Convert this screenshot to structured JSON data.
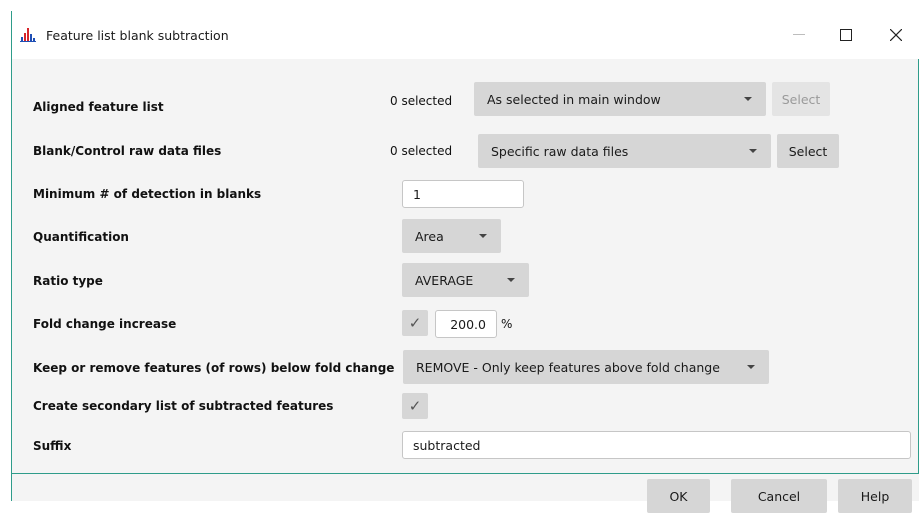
{
  "window": {
    "title": "Feature list blank subtraction",
    "minimize_icon": "minimize-icon",
    "maximize_icon": "maximize-icon",
    "close_icon": "close-icon"
  },
  "rows": {
    "aligned_feature_list": {
      "label": "Aligned feature list",
      "selected_count": "0 selected",
      "combo_value": "As selected in main window",
      "select_label": "Select"
    },
    "blank_files": {
      "label": "Blank/Control raw data files",
      "selected_count": "0 selected",
      "combo_value": "Specific raw data files",
      "select_label": "Select"
    },
    "min_detection": {
      "label": "Minimum # of detection in blanks",
      "value": "1"
    },
    "quantification": {
      "label": "Quantification",
      "value": "Area"
    },
    "ratio_type": {
      "label": "Ratio type",
      "value": "AVERAGE"
    },
    "fold_change": {
      "label": "Fold change increase",
      "checked_glyph": "✓",
      "value": "200.0",
      "unit": "%"
    },
    "keep_remove": {
      "label": "Keep or remove features (of rows) below fold change",
      "value": "REMOVE - Only keep features above fold change"
    },
    "secondary_list": {
      "label": "Create secondary list of subtracted features",
      "checked_glyph": "✓"
    },
    "suffix": {
      "label": "Suffix",
      "value": "subtracted"
    }
  },
  "footer": {
    "ok_label": "OK",
    "cancel_label": "Cancel",
    "help_label": "Help"
  },
  "colors": {
    "accent_border": "#2e9c8a",
    "button_bg": "#d6d6d6",
    "panel_bg": "#f4f4f4"
  }
}
